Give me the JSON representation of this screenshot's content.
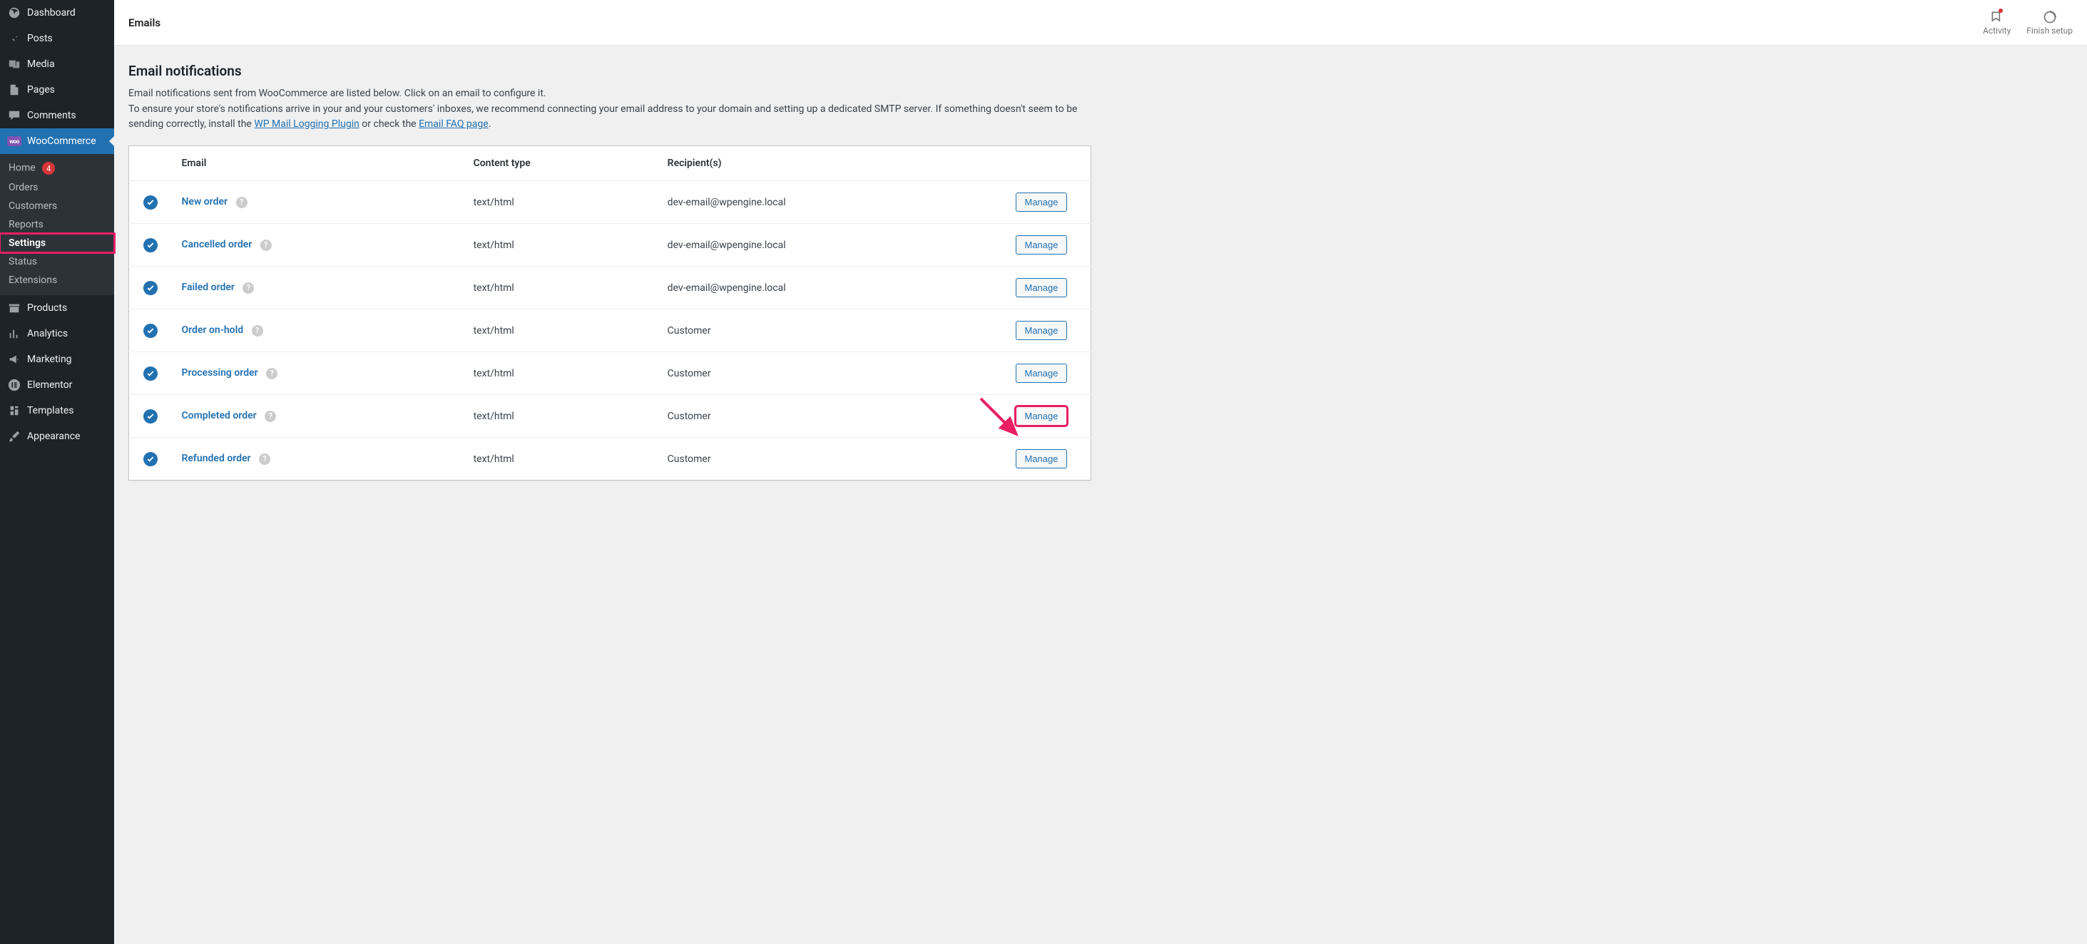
{
  "sidebar": {
    "items": [
      {
        "label": "Dashboard",
        "icon": "dashboard-icon"
      },
      {
        "label": "Posts",
        "icon": "pin-icon"
      },
      {
        "label": "Media",
        "icon": "media-icon"
      },
      {
        "label": "Pages",
        "icon": "page-icon"
      },
      {
        "label": "Comments",
        "icon": "comment-icon"
      },
      {
        "label": "WooCommerce",
        "icon": "woo-icon",
        "current": true
      },
      {
        "label": "Products",
        "icon": "archive-icon"
      },
      {
        "label": "Analytics",
        "icon": "chart-icon"
      },
      {
        "label": "Marketing",
        "icon": "megaphone-icon"
      },
      {
        "label": "Elementor",
        "icon": "elementor-icon"
      },
      {
        "label": "Templates",
        "icon": "templates-icon"
      },
      {
        "label": "Appearance",
        "icon": "brush-icon"
      }
    ],
    "submenu": [
      {
        "label": "Home",
        "badge": "4"
      },
      {
        "label": "Orders"
      },
      {
        "label": "Customers"
      },
      {
        "label": "Reports"
      },
      {
        "label": "Settings",
        "highlight": true
      },
      {
        "label": "Status"
      },
      {
        "label": "Extensions"
      }
    ]
  },
  "topbar": {
    "title": "Emails",
    "activity_label": "Activity",
    "finish_label": "Finish setup"
  },
  "page": {
    "heading": "Email notifications",
    "desc_line1": "Email notifications sent from WooCommerce are listed below. Click on an email to configure it.",
    "desc_line2_a": "To ensure your store's notifications arrive in your and your customers' inboxes, we recommend connecting your email address to your domain and setting up a dedicated SMTP server. If something doesn't seem to be sending correctly, install the ",
    "desc_link1": "WP Mail Logging Plugin",
    "desc_line2_b": " or check the ",
    "desc_link2": "Email FAQ page",
    "desc_line2_c": "."
  },
  "table": {
    "headers": {
      "email": "Email",
      "content_type": "Content type",
      "recipients": "Recipient(s)"
    },
    "manage_label": "Manage",
    "rows": [
      {
        "name": "New order",
        "content_type": "text/html",
        "recipients": "dev-email@wpengine.local"
      },
      {
        "name": "Cancelled order",
        "content_type": "text/html",
        "recipients": "dev-email@wpengine.local"
      },
      {
        "name": "Failed order",
        "content_type": "text/html",
        "recipients": "dev-email@wpengine.local"
      },
      {
        "name": "Order on-hold",
        "content_type": "text/html",
        "recipients": "Customer"
      },
      {
        "name": "Processing order",
        "content_type": "text/html",
        "recipients": "Customer"
      },
      {
        "name": "Completed order",
        "content_type": "text/html",
        "recipients": "Customer",
        "highlight": true
      },
      {
        "name": "Refunded order",
        "content_type": "text/html",
        "recipients": "Customer"
      }
    ]
  },
  "colors": {
    "accent": "#2271b1",
    "annotation": "#e91e63"
  }
}
